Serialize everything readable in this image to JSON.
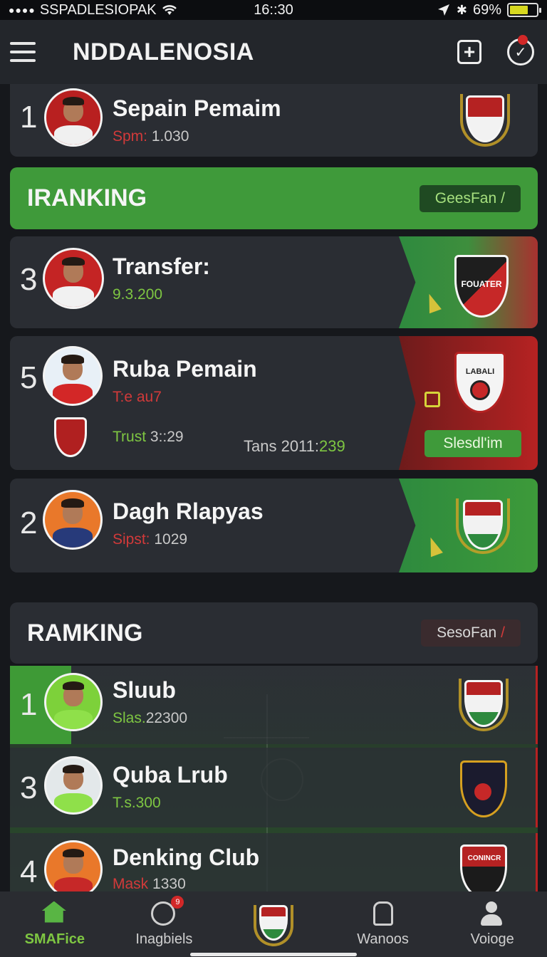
{
  "status_bar": {
    "carrier": "SSPADLESIOPAK",
    "time": "16::30",
    "battery": "69%"
  },
  "header": {
    "title": "NDDALENOSIA"
  },
  "top_card": {
    "rank": "1",
    "name": "Sepain Pemaim",
    "stat_label": "Spm:",
    "stat_value": "1.030"
  },
  "ranking_section": {
    "title": "IRANKING",
    "button": "GeesFan"
  },
  "players": [
    {
      "rank": "3",
      "name": "Transfer:",
      "stat_label": "",
      "stat_value": "9.3.200",
      "crest_text": "FOUATER"
    },
    {
      "rank": "5",
      "name": "Ruba Pemain",
      "stat_label": "T:e au7",
      "stat_value": "",
      "trust_label": "Trust",
      "trust_value": "3::29",
      "trans_label": "Tans 2011:",
      "trans_value": "239",
      "button": "Slesdl'im",
      "crest_text": "LABALI"
    },
    {
      "rank": "2",
      "name": "Dagh Rlapyas",
      "stat_label": "Sipst:",
      "stat_value": "1029"
    }
  ],
  "club_section": {
    "title": "RAMKING",
    "button": "SesoFan"
  },
  "clubs": [
    {
      "rank": "1",
      "name": "Sluub",
      "stat_label": "Slas.",
      "stat_value": "22300"
    },
    {
      "rank": "3",
      "name": "Quba Lrub",
      "stat_label": "T.s.",
      "stat_value": "300"
    },
    {
      "rank": "4",
      "name": "Denking Club",
      "stat_label": "Mask",
      "stat_value": "1330",
      "crest_text": "CONINCR"
    }
  ],
  "bottom_nav": [
    {
      "label": "SMAFice",
      "icon": "home-icon",
      "active": true
    },
    {
      "label": "Inagbiels",
      "icon": "check-circle-icon",
      "badge": "9"
    },
    {
      "label": "",
      "icon": "club-crest-icon"
    },
    {
      "label": "Wanoos",
      "icon": "document-icon"
    },
    {
      "label": "Voioge",
      "icon": "user-icon"
    }
  ],
  "colors": {
    "accent_green": "#3f9a3a",
    "accent_red": "#b52222",
    "background": "#16181c",
    "card": "#2a2d33"
  }
}
